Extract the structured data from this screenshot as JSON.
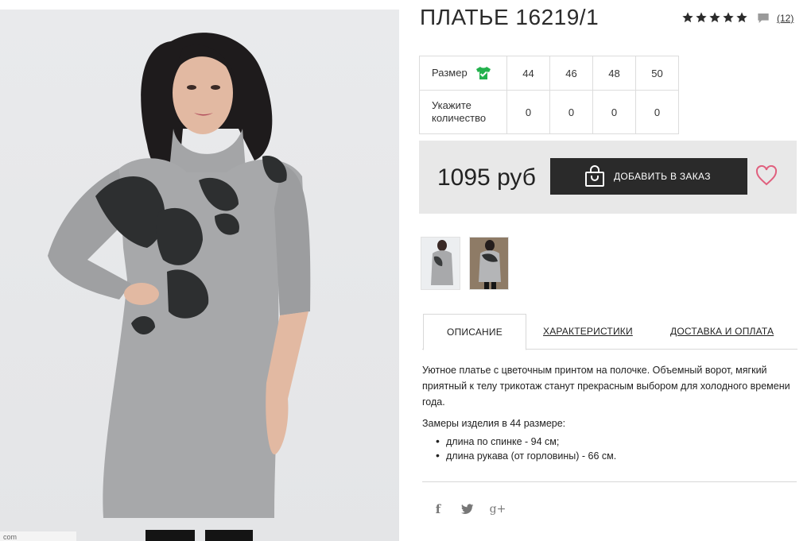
{
  "photo": {
    "caption": "com"
  },
  "product": {
    "title": "ПЛАТЬЕ 16219/1",
    "rating_count": "(12)",
    "rating_stars": 5
  },
  "sizes": {
    "size_label": "Размер",
    "qty_label": "Укажите количество",
    "values": [
      "44",
      "46",
      "48",
      "50"
    ],
    "quantities": [
      "0",
      "0",
      "0",
      "0"
    ]
  },
  "buy": {
    "price": "1095 руб",
    "add_button": "ДОБАВИТЬ В ЗАКАЗ"
  },
  "tabs": {
    "description": "ОПИСАНИЕ",
    "characteristics": "ХАРАКТЕРИСТИКИ",
    "delivery": "ДОСТАВКА И ОПЛАТА"
  },
  "description": {
    "text": "Уютное платье с цветочным принтом на полочке. Объемный ворот, мягкий приятный к телу трикотаж станут прекрасным выбором для холодного времени года.",
    "measures_title": "Замеры изделия в 44 размере:",
    "measures": [
      "длина по спинке - 94 см;",
      "длина рукава (от горловины) - 66 см."
    ]
  },
  "social": {
    "facebook": "f",
    "twitter": "t",
    "gplus": "g+"
  },
  "colors": {
    "accent_green": "#22b14c",
    "heart": "#e0607e",
    "button_bg": "#2a2a2a",
    "panel_bg": "#e8e8e8"
  }
}
